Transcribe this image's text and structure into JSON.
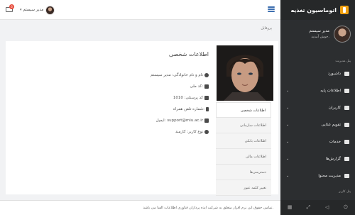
{
  "sidebar": {
    "brand": "اتوماسیون تغذیه",
    "profile": {
      "name": "مدیر سیستم",
      "welcome": "خوش آمدید."
    },
    "section_top": "پنل مدیریت",
    "items": [
      {
        "label": "داشبورد",
        "icon": "dashboard-icon",
        "chevron": false
      },
      {
        "label": "اطلاعات پایه",
        "icon": "table-icon",
        "chevron": true
      },
      {
        "label": "کاربران",
        "icon": "users-icon",
        "chevron": true
      },
      {
        "label": "تقویم غذایی",
        "icon": "calendar-icon",
        "chevron": true
      },
      {
        "label": "خدمات",
        "icon": "list-icon",
        "chevron": true
      },
      {
        "label": "گزارش‌ها",
        "icon": "chart-icon",
        "chevron": true
      },
      {
        "label": "مدیریت محتوا",
        "icon": "copy-icon",
        "chevron": true
      }
    ],
    "section_bottom": "پنل کاربر"
  },
  "header": {
    "user_name": "مدیر سیستم",
    "mail_count": "6"
  },
  "breadcrumb": "پروفایل",
  "profile": {
    "title": "اطلاعات شخصی",
    "fields": [
      {
        "icon": "user-icon",
        "text": "نام و نام خانوادگی: مدیر سیستم"
      },
      {
        "icon": "id-card-icon",
        "text": "کد ملی:"
      },
      {
        "icon": "id-card-icon",
        "text": "کد پرسنلی: 1010"
      },
      {
        "icon": "mobile-icon",
        "text": "شماره تلفن همراه:"
      },
      {
        "icon": "envelope-icon",
        "text": "ایمیل: support@miu.ac.ir"
      },
      {
        "icon": "info-icon",
        "text": "نوع کاربر: کارمند"
      }
    ],
    "menu": [
      "اطلاعات شخصی",
      "اطلاعات سازمانی",
      "اطلاعات بانکی",
      "اطلاعات مالی",
      "دسترسی‌ها",
      "تغییر کلمه عبور"
    ]
  },
  "footer": "تمامی حقوق این نرم افزار متعلق به شرکت ایده پردازان فناوری اطلاعات الفبا می باشد."
}
